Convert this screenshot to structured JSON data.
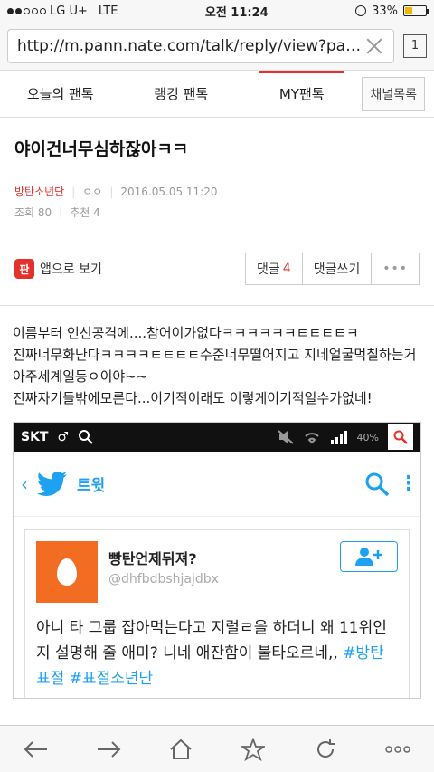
{
  "status": {
    "carrier": "LG U+",
    "network": "LTE",
    "time": "오전 11:24",
    "battery": "33%",
    "battery_level": 0.33
  },
  "browser": {
    "url": "http://m.pann.nate.com/talk/reply/view?pann...",
    "tab_count": "1"
  },
  "nav": {
    "items": [
      {
        "label": "오늘의 팬톡"
      },
      {
        "label": "랭킹 팬톡"
      },
      {
        "label": "MY팬톡"
      }
    ],
    "channel_button": "채널목록"
  },
  "post": {
    "title": "야이건너무심하잖아ㅋㅋ",
    "author": "방탄소년단",
    "author_id": "ㅇㅇ",
    "date": "2016.05.05 11:20",
    "views": "조회 80",
    "recommends": "추천 4",
    "app_link": "앱으로 보기",
    "comments_label": "댓글",
    "comments_count": "4",
    "write_comment": "댓글쓰기",
    "more": "•••",
    "body_lines": [
      "이름부터 인신공격에....참어이가없다ㅋㅋㅋㅋㅋㅋㅌㅌㅌㅌㅋ",
      "진짜너무화난다ㅋㅋㅋㅋㅌㅌㅌㅌ수준너무떨어지고 지네얼굴먹칠하는거 아주세계일등ㅇ이야~~",
      "진짜자기들밖에모른다...이기적이래도 이렇게이기적일수가없네!"
    ]
  },
  "embed": {
    "inner_carrier": "SKT",
    "inner_battery": "40%",
    "tweet_header": "트윗",
    "tweet_name": "빵탄언제뒤져?",
    "tweet_handle": "@dhfbdbshjajdbx",
    "tweet_text": "아니 타 그룹 잡아먹는다고 지럴ㄹ을 하더니 왜 11위인지 설명해 줄 애미? 니네 애잔함이 불타오르네,,",
    "hashtag1": "#방탄표절",
    "hashtag2": "#표절소년단"
  },
  "colors": {
    "accent": "#e4312b",
    "twitter": "#1da1f2"
  }
}
